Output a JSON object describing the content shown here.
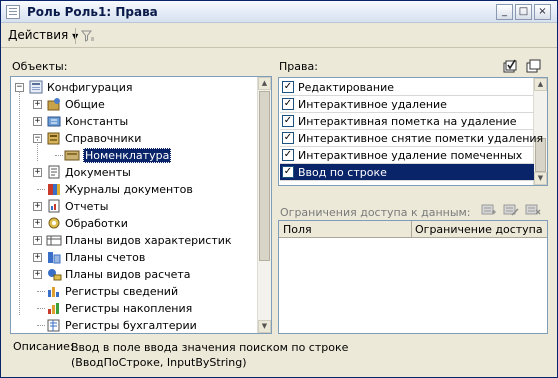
{
  "window": {
    "title": "Роль Роль1: Права",
    "controls": {
      "minimize": "_",
      "maximize": "□",
      "close": "×"
    }
  },
  "menu": {
    "actions_label": "Действия"
  },
  "objects": {
    "label": "Объекты:",
    "tree": [
      {
        "label": "Конфигурация",
        "icon": "config-icon",
        "expander": "−"
      },
      {
        "label": "Общие",
        "icon": "common-icon",
        "expander": "+"
      },
      {
        "label": "Константы",
        "icon": "constants-icon",
        "expander": "+"
      },
      {
        "label": "Справочники",
        "icon": "catalogs-icon",
        "expander": "−"
      },
      {
        "label": "Номенклатура",
        "icon": "catalog-item-icon",
        "expander": "",
        "selected": true
      },
      {
        "label": "Документы",
        "icon": "documents-icon",
        "expander": "+"
      },
      {
        "label": "Журналы документов",
        "icon": "journals-icon",
        "expander": ""
      },
      {
        "label": "Отчеты",
        "icon": "reports-icon",
        "expander": "+"
      },
      {
        "label": "Обработки",
        "icon": "processing-icon",
        "expander": "+"
      },
      {
        "label": "Планы видов характеристик",
        "icon": "char-plans-icon",
        "expander": "+"
      },
      {
        "label": "Планы счетов",
        "icon": "accounts-plans-icon",
        "expander": "+"
      },
      {
        "label": "Планы видов расчета",
        "icon": "calc-plans-icon",
        "expander": "+"
      },
      {
        "label": "Регистры сведений",
        "icon": "info-registers-icon",
        "expander": ""
      },
      {
        "label": "Регистры накопления",
        "icon": "accum-registers-icon",
        "expander": ""
      },
      {
        "label": "Регистры бухгалтерии",
        "icon": "accounting-registers-icon",
        "expander": ""
      }
    ]
  },
  "rights": {
    "label": "Права:",
    "items": [
      {
        "label": "Редактирование",
        "checked": true,
        "selected": false
      },
      {
        "label": "Интерактивное удаление",
        "checked": true,
        "selected": false
      },
      {
        "label": "Интерактивная пометка на удаление",
        "checked": true,
        "selected": false
      },
      {
        "label": "Интерактивное снятие пометки удаления",
        "checked": true,
        "selected": false
      },
      {
        "label": "Интерактивное удаление помеченных",
        "checked": true,
        "selected": false
      },
      {
        "label": "Ввод по строке",
        "checked": true,
        "selected": true
      }
    ]
  },
  "restrictions": {
    "label": "Ограничения доступа к данным:",
    "columns": [
      "Поля",
      "Ограничение доступа"
    ]
  },
  "description": {
    "label": "Описание:",
    "line1": "Ввод в поле ввода значения поиском по строке",
    "line2": "(ВводПоСтроке, InputByString)"
  },
  "colors": {
    "selection": "#0a246a",
    "window_bg": "#ece9d8",
    "panel_border": "#7f9db9",
    "check_color": "#21a121"
  }
}
